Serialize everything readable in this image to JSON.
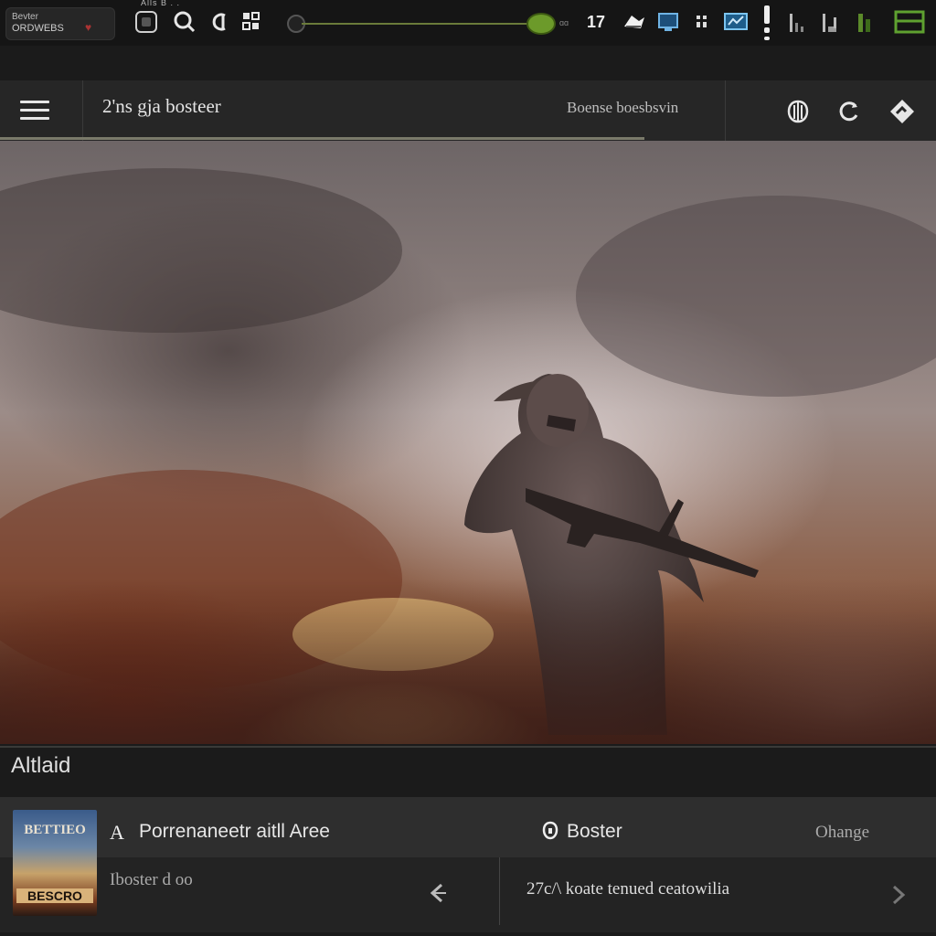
{
  "system_bar": {
    "app_label_line1": "Bevter",
    "app_label_line2": "ORDWEBS",
    "tiny_top_text": "Alls B . .",
    "clock": "17",
    "slider": {
      "value": 1.0,
      "accent": "#6c9a2a"
    },
    "icons": [
      "app-box-icon",
      "search-icon",
      "wallet-icon",
      "grid-icon",
      "cloud-icon",
      "monitor-icon",
      "chat-icon",
      "map-icon",
      "menu-dots-icon",
      "signal-icon",
      "battery-icon",
      "window-icon"
    ]
  },
  "header": {
    "title": "2'ns gja bosteer",
    "subtitle": "Boense boesbsvin",
    "icons": [
      "shield-icon",
      "refresh-icon",
      "navigate-icon"
    ]
  },
  "section": {
    "title": "Altlaid"
  },
  "card": {
    "thumb_title": "BETTIEO",
    "thumb_badge": "BESCRO",
    "prefix": "A",
    "title": "Porrenaneetr aitll Aree",
    "booster_label": "Boster",
    "change_label": "Ohange",
    "subtitle": "Iboster d oo",
    "status": "27c/\\ koate tenued ceatowilia"
  },
  "colors": {
    "accent": "#6c9a2a",
    "background": "#1b1b1b",
    "header": "#262626"
  }
}
